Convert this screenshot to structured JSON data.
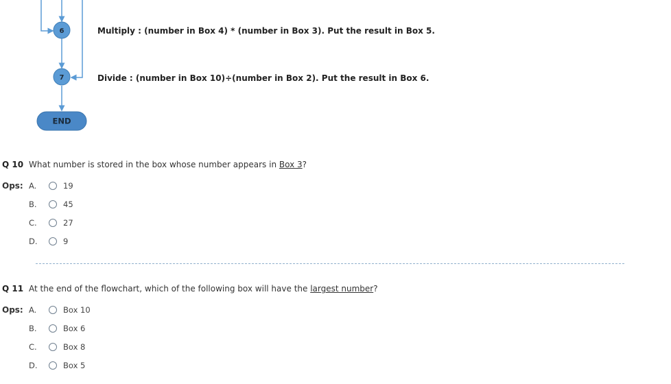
{
  "flowchart": {
    "nodes": [
      {
        "label": "6",
        "instruction": "Multiply : (number in Box 4) * (number in Box 3). Put the result in Box 5."
      },
      {
        "label": "7",
        "instruction": "Divide : (number in Box 10)÷(number in Box 2). Put the result in Box 6."
      }
    ],
    "end_label": "END",
    "colors": {
      "node_fill": "#5b9bd5",
      "line": "#5b9bd5",
      "end_fill": "#4a88c7"
    }
  },
  "questions": [
    {
      "number": "Q 10",
      "text_before": "What number is stored in the box whose number appears in ",
      "text_link": "Box 3",
      "text_after": "?",
      "ops_label": "Ops:",
      "options": [
        {
          "letter": "A.",
          "text": "19"
        },
        {
          "letter": "B.",
          "text": "45"
        },
        {
          "letter": "C.",
          "text": "27"
        },
        {
          "letter": "D.",
          "text": "9"
        }
      ]
    },
    {
      "number": "Q 11",
      "text_before": "At the end of the flowchart, which of the following box will have the ",
      "text_link": "largest number",
      "text_after": "?",
      "ops_label": "Ops:",
      "options": [
        {
          "letter": "A.",
          "text": "Box 10"
        },
        {
          "letter": "B.",
          "text": "Box 6"
        },
        {
          "letter": "C.",
          "text": "Box 8"
        },
        {
          "letter": "D.",
          "text": "Box 5"
        }
      ]
    }
  ]
}
